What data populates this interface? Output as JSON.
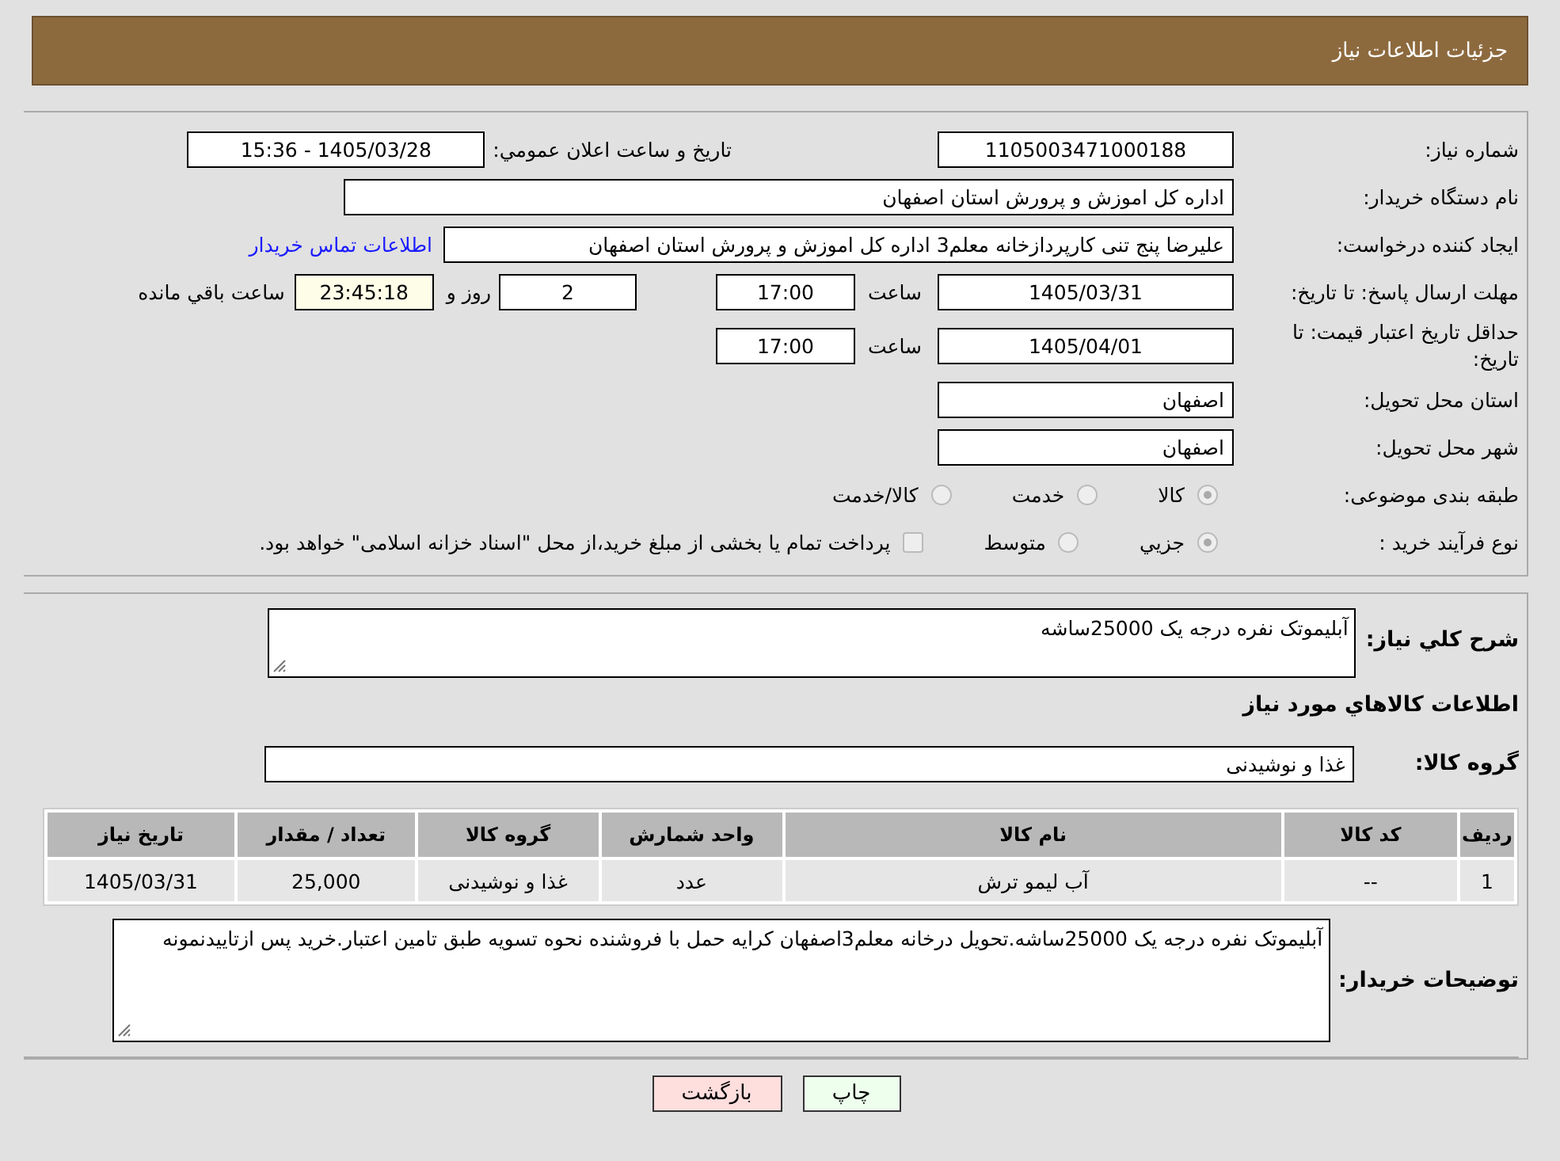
{
  "header": {
    "title": "جزئیات اطلاعات نیاز"
  },
  "need_number": {
    "label": "شماره نیاز:",
    "value": "1105003471000188"
  },
  "announce": {
    "label": "تاریخ و ساعت اعلان عمومي:",
    "value": "1405/03/28 - 15:36"
  },
  "buyer": {
    "label": "نام دستگاه خریدار:",
    "value": "اداره کل اموزش و پرورش استان اصفهان"
  },
  "creator": {
    "label": "ایجاد کننده درخواست:",
    "value": "علیرضا پنج تنی کارپردازخانه معلم3 اداره کل اموزش و پرورش استان اصفهان",
    "link": "اطلاعات تماس خریدار"
  },
  "deadline": {
    "label": "مهلت ارسال پاسخ: تا تاریخ:",
    "date": "1405/03/31",
    "time_label": "ساعت",
    "time": "17:00",
    "days": "2",
    "days_label": "روز و",
    "remaining": "23:45:18",
    "remaining_label": "ساعت باقي مانده"
  },
  "validity": {
    "label": "حداقل تاریخ اعتبار قیمت: تا تاریخ:",
    "date": "1405/04/01",
    "time_label": "ساعت",
    "time": "17:00"
  },
  "province": {
    "label": "استان محل تحویل:",
    "value": "اصفهان"
  },
  "city": {
    "label": "شهر محل تحویل:",
    "value": "اصفهان"
  },
  "category": {
    "label": "طبقه بندی موضوعی:",
    "options": [
      {
        "label": "کالا",
        "selected": true
      },
      {
        "label": "خدمت",
        "selected": false
      },
      {
        "label": "کالا/خدمت",
        "selected": false
      }
    ]
  },
  "process": {
    "label": "نوع فرآیند خرید :",
    "options": [
      {
        "label": "جزيي",
        "selected": true
      },
      {
        "label": "متوسط",
        "selected": false
      }
    ],
    "payment": {
      "label": "پرداخت تمام یا بخشی از مبلغ خرید،از محل \"اسناد خزانه اسلامی\" خواهد بود.",
      "checked": false
    }
  },
  "description": {
    "label": "شرح کلي نیاز:",
    "value": "آبلیموتک نفره درجه یک 25000ساشه"
  },
  "goods_title": "اطلاعات کالاهاي مورد نیاز",
  "goods_group": {
    "label": "گروه کالا:",
    "value": "غذا و نوشیدنی"
  },
  "table": {
    "columns": [
      "ردیف",
      "کد کالا",
      "نام کالا",
      "واحد شمارش",
      "گروه کالا",
      "تعداد / مقدار",
      "تاریخ نیاز"
    ],
    "rows": [
      [
        "1",
        "--",
        "آب لیمو ترش",
        "عدد",
        "غذا و نوشیدنی",
        "25,000",
        "1405/03/31"
      ]
    ]
  },
  "buyer_notes": {
    "label": "توضیحات خریدار:",
    "value": "آبلیموتک نفره درجه یک 25000ساشه.تحویل درخانه معلم3اصفهان کرایه حمل با فروشنده نحوه تسویه طبق تامین اعتبار.خرید پس ازتاییدنمونه"
  },
  "buttons": [
    {
      "label": "چاپ",
      "kind": "print"
    },
    {
      "label": "بازگشت",
      "kind": "back"
    }
  ]
}
